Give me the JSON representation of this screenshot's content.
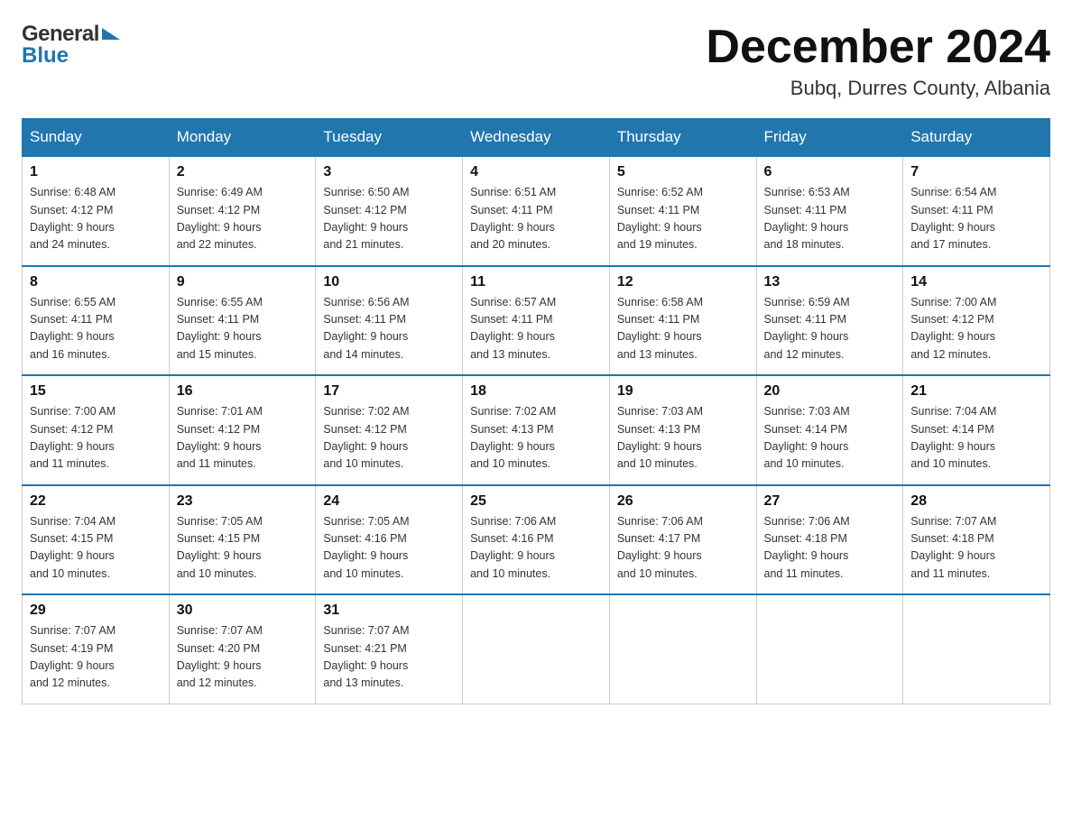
{
  "header": {
    "month_year": "December 2024",
    "location": "Bubq, Durres County, Albania"
  },
  "weekdays": [
    "Sunday",
    "Monday",
    "Tuesday",
    "Wednesday",
    "Thursday",
    "Friday",
    "Saturday"
  ],
  "weeks": [
    [
      {
        "day": "1",
        "sunrise": "6:48 AM",
        "sunset": "4:12 PM",
        "daylight": "9 hours and 24 minutes."
      },
      {
        "day": "2",
        "sunrise": "6:49 AM",
        "sunset": "4:12 PM",
        "daylight": "9 hours and 22 minutes."
      },
      {
        "day": "3",
        "sunrise": "6:50 AM",
        "sunset": "4:12 PM",
        "daylight": "9 hours and 21 minutes."
      },
      {
        "day": "4",
        "sunrise": "6:51 AM",
        "sunset": "4:11 PM",
        "daylight": "9 hours and 20 minutes."
      },
      {
        "day": "5",
        "sunrise": "6:52 AM",
        "sunset": "4:11 PM",
        "daylight": "9 hours and 19 minutes."
      },
      {
        "day": "6",
        "sunrise": "6:53 AM",
        "sunset": "4:11 PM",
        "daylight": "9 hours and 18 minutes."
      },
      {
        "day": "7",
        "sunrise": "6:54 AM",
        "sunset": "4:11 PM",
        "daylight": "9 hours and 17 minutes."
      }
    ],
    [
      {
        "day": "8",
        "sunrise": "6:55 AM",
        "sunset": "4:11 PM",
        "daylight": "9 hours and 16 minutes."
      },
      {
        "day": "9",
        "sunrise": "6:55 AM",
        "sunset": "4:11 PM",
        "daylight": "9 hours and 15 minutes."
      },
      {
        "day": "10",
        "sunrise": "6:56 AM",
        "sunset": "4:11 PM",
        "daylight": "9 hours and 14 minutes."
      },
      {
        "day": "11",
        "sunrise": "6:57 AM",
        "sunset": "4:11 PM",
        "daylight": "9 hours and 13 minutes."
      },
      {
        "day": "12",
        "sunrise": "6:58 AM",
        "sunset": "4:11 PM",
        "daylight": "9 hours and 13 minutes."
      },
      {
        "day": "13",
        "sunrise": "6:59 AM",
        "sunset": "4:11 PM",
        "daylight": "9 hours and 12 minutes."
      },
      {
        "day": "14",
        "sunrise": "7:00 AM",
        "sunset": "4:12 PM",
        "daylight": "9 hours and 12 minutes."
      }
    ],
    [
      {
        "day": "15",
        "sunrise": "7:00 AM",
        "sunset": "4:12 PM",
        "daylight": "9 hours and 11 minutes."
      },
      {
        "day": "16",
        "sunrise": "7:01 AM",
        "sunset": "4:12 PM",
        "daylight": "9 hours and 11 minutes."
      },
      {
        "day": "17",
        "sunrise": "7:02 AM",
        "sunset": "4:12 PM",
        "daylight": "9 hours and 10 minutes."
      },
      {
        "day": "18",
        "sunrise": "7:02 AM",
        "sunset": "4:13 PM",
        "daylight": "9 hours and 10 minutes."
      },
      {
        "day": "19",
        "sunrise": "7:03 AM",
        "sunset": "4:13 PM",
        "daylight": "9 hours and 10 minutes."
      },
      {
        "day": "20",
        "sunrise": "7:03 AM",
        "sunset": "4:14 PM",
        "daylight": "9 hours and 10 minutes."
      },
      {
        "day": "21",
        "sunrise": "7:04 AM",
        "sunset": "4:14 PM",
        "daylight": "9 hours and 10 minutes."
      }
    ],
    [
      {
        "day": "22",
        "sunrise": "7:04 AM",
        "sunset": "4:15 PM",
        "daylight": "9 hours and 10 minutes."
      },
      {
        "day": "23",
        "sunrise": "7:05 AM",
        "sunset": "4:15 PM",
        "daylight": "9 hours and 10 minutes."
      },
      {
        "day": "24",
        "sunrise": "7:05 AM",
        "sunset": "4:16 PM",
        "daylight": "9 hours and 10 minutes."
      },
      {
        "day": "25",
        "sunrise": "7:06 AM",
        "sunset": "4:16 PM",
        "daylight": "9 hours and 10 minutes."
      },
      {
        "day": "26",
        "sunrise": "7:06 AM",
        "sunset": "4:17 PM",
        "daylight": "9 hours and 10 minutes."
      },
      {
        "day": "27",
        "sunrise": "7:06 AM",
        "sunset": "4:18 PM",
        "daylight": "9 hours and 11 minutes."
      },
      {
        "day": "28",
        "sunrise": "7:07 AM",
        "sunset": "4:18 PM",
        "daylight": "9 hours and 11 minutes."
      }
    ],
    [
      {
        "day": "29",
        "sunrise": "7:07 AM",
        "sunset": "4:19 PM",
        "daylight": "9 hours and 12 minutes."
      },
      {
        "day": "30",
        "sunrise": "7:07 AM",
        "sunset": "4:20 PM",
        "daylight": "9 hours and 12 minutes."
      },
      {
        "day": "31",
        "sunrise": "7:07 AM",
        "sunset": "4:21 PM",
        "daylight": "9 hours and 13 minutes."
      },
      null,
      null,
      null,
      null
    ]
  ],
  "labels": {
    "sunrise": "Sunrise:",
    "sunset": "Sunset:",
    "daylight": "Daylight:"
  }
}
